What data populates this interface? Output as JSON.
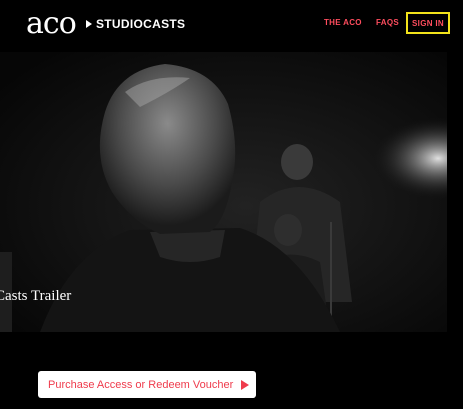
{
  "header": {
    "logo": "aco",
    "brand": "STUDIOCASTS",
    "nav": {
      "the_aco": "THE ACO",
      "faqs": "FAQS",
      "sign_in": "SIGN IN"
    }
  },
  "hero": {
    "title": "Casts Trailer"
  },
  "cta": {
    "label": "Purchase Access or Redeem Voucher",
    "icon": "play-icon"
  },
  "colors": {
    "accent": "#ff4d5e",
    "highlight": "#f2e31b",
    "background": "#000000"
  }
}
